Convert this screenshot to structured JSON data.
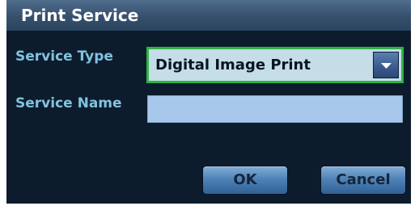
{
  "dialog": {
    "title": "Print Service",
    "service_type": {
      "label": "Service Type",
      "selected_value": "Digital Image Print",
      "dropdown_icon": "chevron-down-icon"
    },
    "service_name": {
      "label": "Service Name",
      "value": ""
    },
    "buttons": {
      "ok_label": "OK",
      "cancel_label": "Cancel"
    }
  },
  "colors": {
    "background": "#0d1c2c",
    "title_bar": "#36506c",
    "label_text": "#80c3e0",
    "focus_border": "#2fb346",
    "select_fill": "#c4dde7",
    "input_fill": "#a7c8ea",
    "button_fill": "#4f83b8"
  }
}
